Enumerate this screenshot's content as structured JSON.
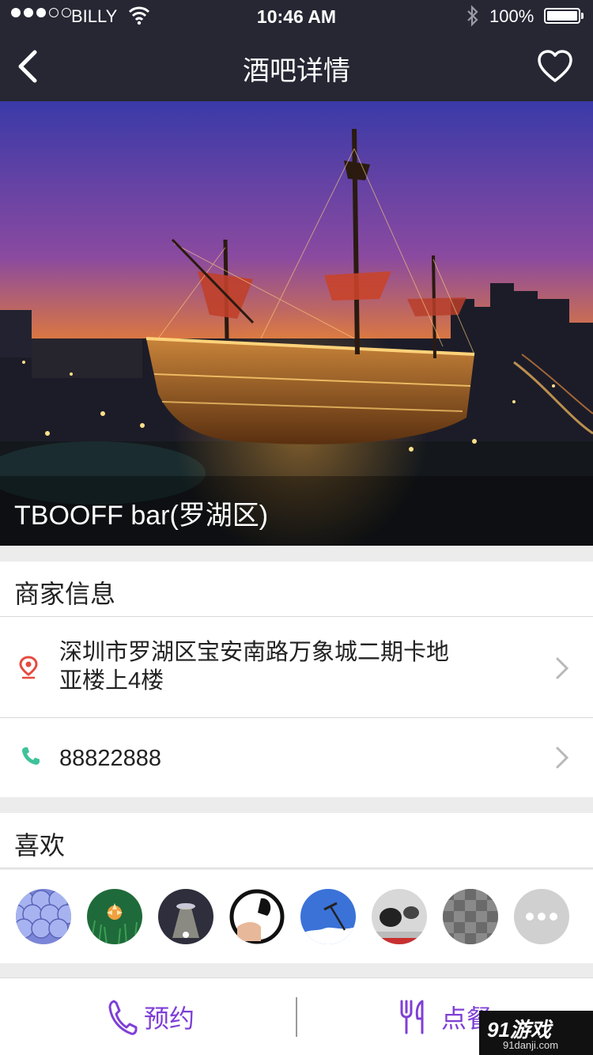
{
  "status_bar": {
    "carrier": "BILLY",
    "time": "10:46 AM",
    "battery": "100%",
    "icons": [
      "signal-dots",
      "wifi-icon",
      "bluetooth-icon",
      "battery-icon"
    ]
  },
  "nav": {
    "title": "酒吧详情",
    "back_icon": "back-chevron-icon",
    "favorite_icon": "heart-icon"
  },
  "hero": {
    "bar_name": "TBOOFF bar(罗湖区)"
  },
  "merchant": {
    "heading": "商家信息",
    "address_line1": "深圳市罗湖区宝安南路万象城二期卡地",
    "address_line2": "亚楼上4楼",
    "phone": "88822888",
    "address_icon_color": "#e84a3f",
    "phone_icon_color": "#3fc29a"
  },
  "likes": {
    "heading": "喜欢",
    "avatar_count_shown": 7,
    "more_icon": "more-dots-icon"
  },
  "bottom_bar": {
    "reserve_label": "预约",
    "order_label": "点餐",
    "accent_color": "#7f3fd6"
  },
  "watermark": {
    "brand": "91游戏",
    "site": "91danji.com"
  }
}
